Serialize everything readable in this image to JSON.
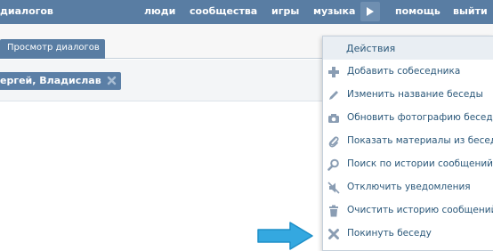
{
  "topbar": {
    "title": "диалогов",
    "links": [
      "люди",
      "сообщества",
      "игры",
      "музыка",
      "помощь",
      "выйти"
    ]
  },
  "tabs": {
    "active_label": "Просмотр диалогов"
  },
  "chat": {
    "participants": "ергей, Владислав"
  },
  "menu": {
    "header": "Действия",
    "items": [
      {
        "label": "Добавить собеседника",
        "icon": "add-user-icon"
      },
      {
        "label": "Изменить название беседы",
        "icon": "pencil-icon"
      },
      {
        "label": "Обновить фотографию беседы",
        "icon": "camera-icon"
      },
      {
        "label": "Показать материалы из беседы",
        "icon": "paperclip-icon"
      },
      {
        "label": "Поиск по истории сообщений",
        "icon": "search-icon"
      },
      {
        "label": "Отключить уведомления",
        "icon": "mute-icon"
      },
      {
        "label": "Очистить историю сообщений",
        "icon": "trash-icon"
      },
      {
        "label": "Покинуть беседу",
        "icon": "close-icon"
      }
    ]
  },
  "colors": {
    "topbar": "#597da3",
    "link": "#2b587a",
    "arrow": "#34a8e0",
    "icon": "#8a9db3"
  }
}
